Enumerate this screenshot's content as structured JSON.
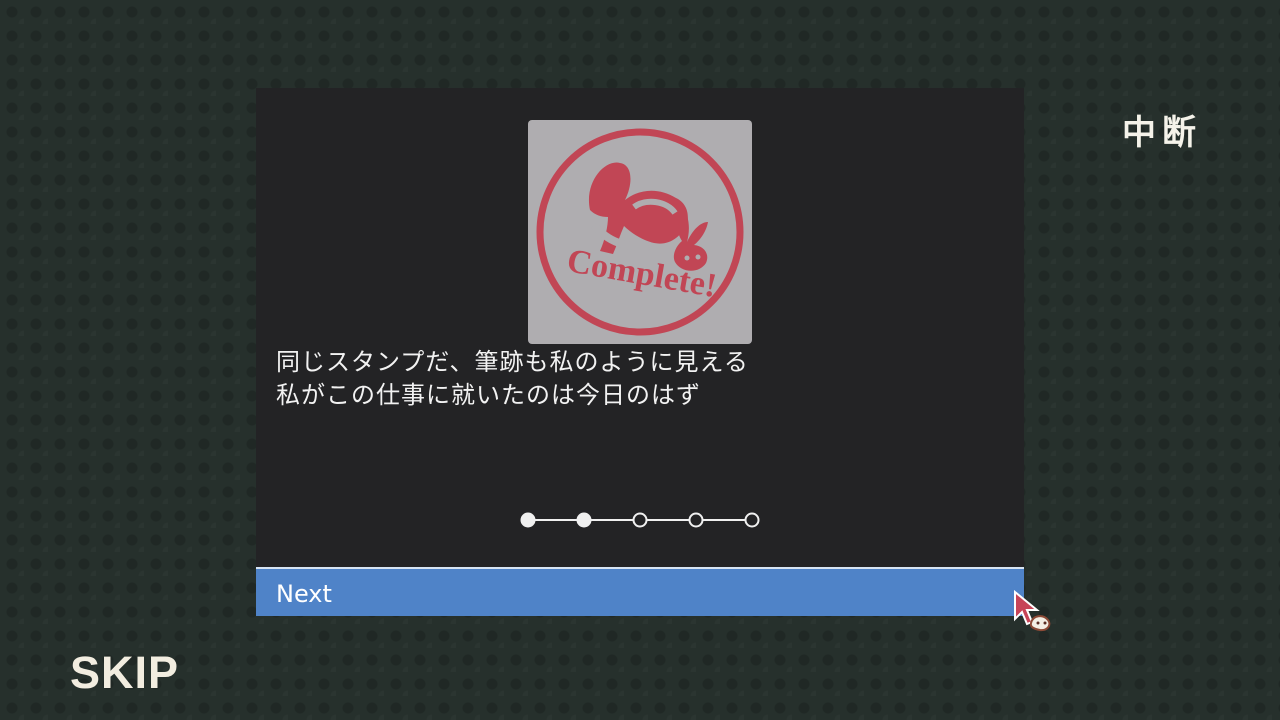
{
  "dialog": {
    "stamp": {
      "text": "Complete!",
      "color": "#c14655",
      "background": "#afadb0"
    },
    "message_lines": [
      "同じスタンプだ、筆跡も私のように見える",
      "私がこの仕事に就いたのは今日のはず"
    ],
    "progress": {
      "current": 2,
      "total": 5
    },
    "next_label": "Next"
  },
  "controls": {
    "suspend_label": "中断",
    "skip_label": "SKIP"
  },
  "colors": {
    "background": "#26302c",
    "panel": "#232325",
    "button": "#4f83c8",
    "text": "#f2f2f2"
  },
  "icons": {
    "stamp": "complete-rabbit-stamp-icon",
    "cursor": "pointer-cursor-icon"
  }
}
